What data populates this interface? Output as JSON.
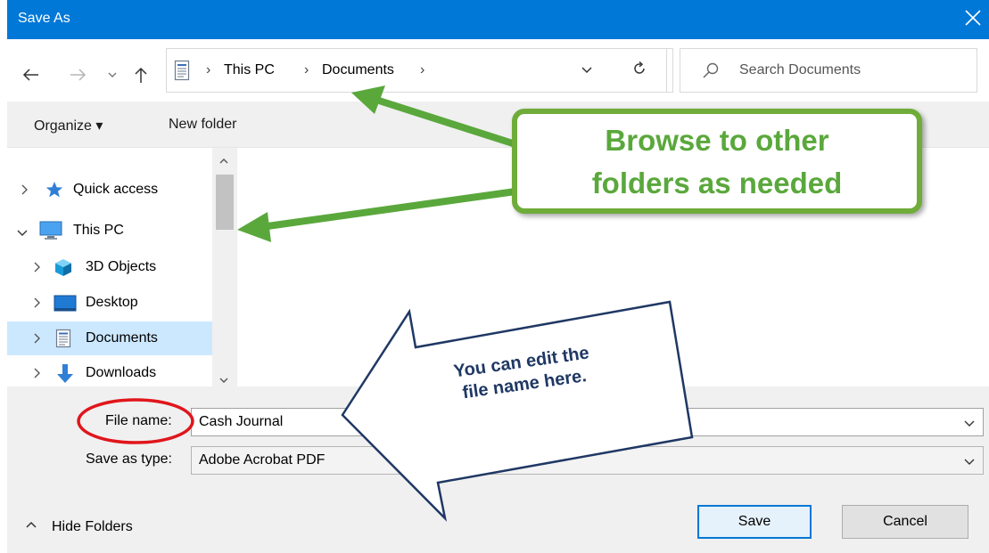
{
  "dialog": {
    "title": "Save As"
  },
  "address_bar": {
    "crumbs": [
      "This PC",
      "Documents"
    ],
    "search_placeholder": "Search Documents"
  },
  "command_bar": {
    "organize_label": "Organize ▾",
    "new_folder_label": "New folder"
  },
  "nav_pane": {
    "items": [
      {
        "label": "Quick access",
        "icon": "star-icon"
      },
      {
        "label": "This PC",
        "icon": "monitor-icon"
      },
      {
        "label": "3D Objects",
        "icon": "cube-icon"
      },
      {
        "label": "Desktop",
        "icon": "desktop-icon"
      },
      {
        "label": "Documents",
        "icon": "document-icon",
        "selected": true
      },
      {
        "label": "Downloads",
        "icon": "download-icon"
      }
    ]
  },
  "form": {
    "file_name_label": "File name:",
    "file_name_value": "Cash Journal",
    "save_type_label": "Save as type:",
    "save_type_value": "Adobe Acrobat PDF"
  },
  "footer": {
    "hide_folders_label": "Hide Folders",
    "save_label": "Save",
    "cancel_label": "Cancel"
  },
  "annotations": {
    "callout_lines": [
      "Browse to other",
      "folders as needed"
    ],
    "arrow_lines": [
      "You can edit the",
      "file name here."
    ],
    "callout_color": "#6fac3a",
    "circle_color": "#e0161b",
    "arrow_outline_color": "#1f3864"
  },
  "colors": {
    "title_bar": "#0078d7",
    "selection": "#cce8ff"
  }
}
